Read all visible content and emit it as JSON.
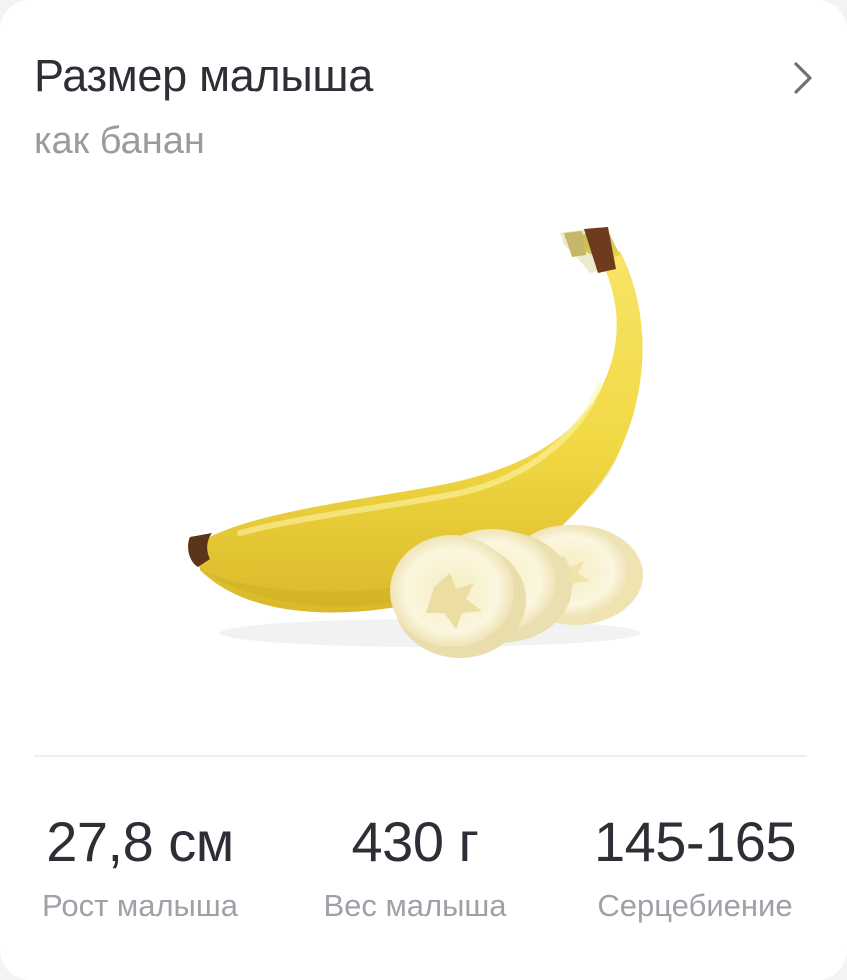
{
  "card": {
    "title": "Размер малыша",
    "subtitle": "как банан",
    "chevron_icon": "chevron-right-icon",
    "illustration": "banana-with-slices"
  },
  "stats": [
    {
      "value": "27,8 см",
      "label": "Рост малыша"
    },
    {
      "value": "430 г",
      "label": "Вес малыша"
    },
    {
      "value": "145-165",
      "label": "Серцебиение"
    }
  ],
  "colors": {
    "title": "#2e2f36",
    "subtitle": "#9a9ba1",
    "banana_yellow": "#f3dc4a",
    "banana_flesh": "#fbf5d8"
  }
}
